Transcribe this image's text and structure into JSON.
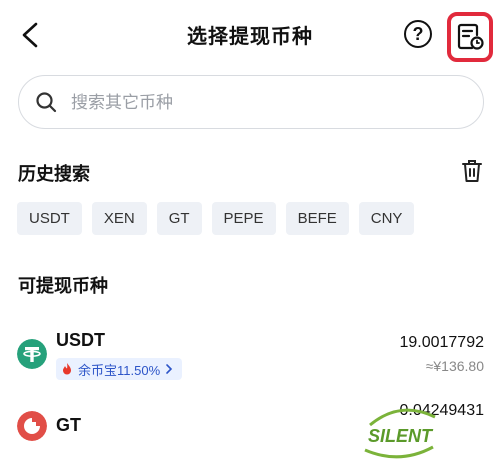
{
  "header": {
    "title": "选择提现币种"
  },
  "search": {
    "placeholder": "搜索其它币种"
  },
  "history": {
    "title": "历史搜索",
    "items": [
      "USDT",
      "XEN",
      "GT",
      "PEPE",
      "BEFE",
      "CNY"
    ]
  },
  "available": {
    "title": "可提现币种"
  },
  "coins": [
    {
      "name": "USDT",
      "amount": "19.0017792",
      "cny": "≈¥136.80",
      "badge": "余币宝11.50%",
      "icon": "tether-icon",
      "color": "#26a17b"
    },
    {
      "name": "GT",
      "amount": "0.04249431",
      "icon": "gatetoken-icon",
      "color": "#e14e47"
    }
  ],
  "watermark": "SILENT",
  "colors": {
    "highlight": "#e12a3c",
    "badge_text": "#2d55c8",
    "badge_bg": "#eaf1ff",
    "flame": "#e8382b"
  }
}
